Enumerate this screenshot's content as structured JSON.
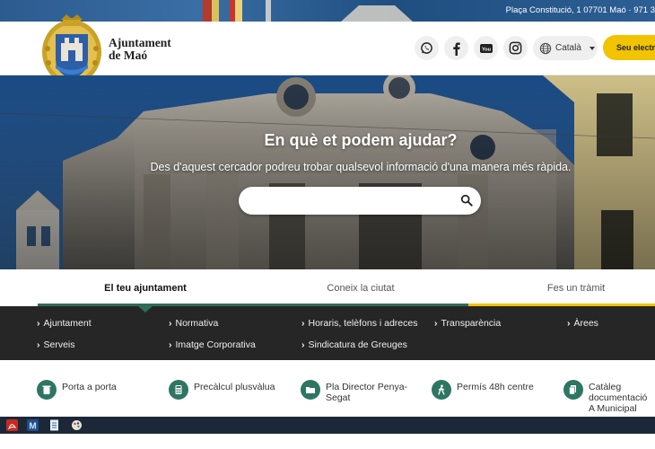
{
  "top_bar": {
    "address": "Plaça Constitució, 1 07701 Maó · 971 3"
  },
  "header": {
    "brand_line1": "Ajuntament",
    "brand_line2": "de Maó",
    "language": "Català",
    "eseu_label": "Seu electrònica",
    "social": [
      "whatsapp-icon",
      "facebook-icon",
      "youtube-icon",
      "instagram-icon"
    ]
  },
  "hero": {
    "title": "En què et podem ajudar?",
    "subtitle": "Des d'aquest cercador podreu trobar qualsevol informació d'una manera més ràpida.",
    "search_placeholder": ""
  },
  "tabs": [
    {
      "label": "El teu ajuntament",
      "active": true,
      "color": "#2e6c57"
    },
    {
      "label": "Coneix la ciutat",
      "active": false,
      "color": "#2e6c57"
    },
    {
      "label": "Fes un tràmit",
      "active": false,
      "color": "#f2c300"
    }
  ],
  "menu": [
    {
      "label": "Ajuntament"
    },
    {
      "label": "Normativa"
    },
    {
      "label": "Horaris, telèfons i adreces"
    },
    {
      "label": "Transparència"
    },
    {
      "label": "Àrees"
    },
    {
      "label": "Serveis"
    },
    {
      "label": "Imatge Corporativa"
    },
    {
      "label": "Sindicatura de Greuges"
    }
  ],
  "quick_links": [
    {
      "label": "Porta a porta",
      "icon": "recycle-bin-icon"
    },
    {
      "label": "Precàlcul plusvàlua",
      "icon": "calculator-icon"
    },
    {
      "label": "Pla Director Penya-Segat",
      "icon": "folder-icon"
    },
    {
      "label": "Permís 48h centre",
      "icon": "walking-person-icon"
    },
    {
      "label": "Catàleg documentació A Municipal",
      "icon": "documents-icon"
    }
  ],
  "colors": {
    "accent_green": "#2e6c57",
    "accent_yellow": "#f2c300",
    "menu_bg": "#262626",
    "taskbar_bg": "#1c2838"
  }
}
